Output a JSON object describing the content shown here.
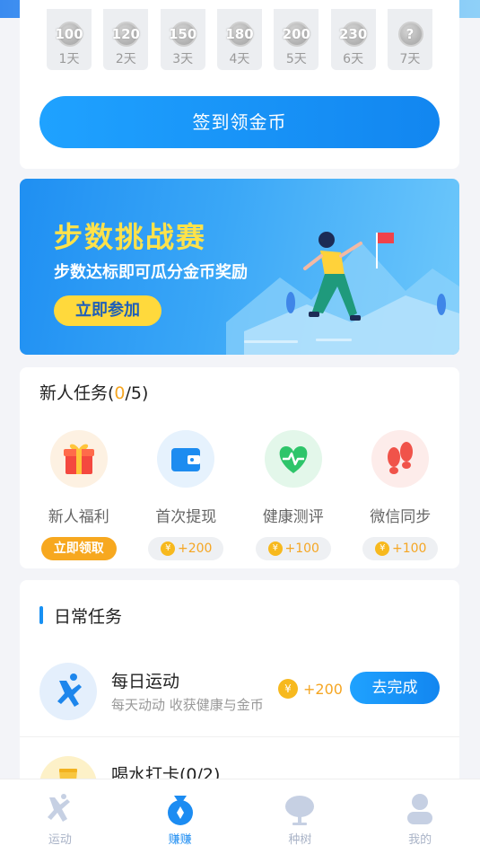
{
  "signin": {
    "days": [
      {
        "value": "100",
        "label": "1天"
      },
      {
        "value": "120",
        "label": "2天"
      },
      {
        "value": "150",
        "label": "3天"
      },
      {
        "value": "180",
        "label": "4天"
      },
      {
        "value": "200",
        "label": "5天"
      },
      {
        "value": "230",
        "label": "6天"
      },
      {
        "value": "?",
        "label": "7天"
      }
    ],
    "button_label": "签到领金币"
  },
  "banner": {
    "title": "步数挑战赛",
    "subtitle": "步数达标即可瓜分金币奖励",
    "button_label": "立即参加"
  },
  "new_tasks": {
    "title_prefix": "新人任务(",
    "done": "0",
    "title_suffix": "/5)",
    "items": [
      {
        "name": "新人福利",
        "action": "立即领取",
        "icon": "gift-icon"
      },
      {
        "name": "首次提现",
        "reward": "+200",
        "icon": "wallet-icon"
      },
      {
        "name": "健康测评",
        "reward": "+100",
        "icon": "heart-pulse-icon"
      },
      {
        "name": "微信同步",
        "reward": "+100",
        "icon": "footprints-icon"
      }
    ]
  },
  "daily_tasks": {
    "title": "日常任务",
    "items": [
      {
        "title": "每日运动",
        "subtitle": "每天动动 收获健康与金币",
        "reward": "+200",
        "button": "去完成",
        "icon": "runner-icon"
      },
      {
        "title": "喝水打卡(0/2)",
        "icon": "water-cup-icon"
      }
    ]
  },
  "coin_symbol": "¥",
  "nav": {
    "items": [
      {
        "label": "运动",
        "icon": "runner-icon",
        "active": false
      },
      {
        "label": "赚赚",
        "icon": "money-bag-icon",
        "active": true
      },
      {
        "label": "种树",
        "icon": "tree-icon",
        "active": false
      },
      {
        "label": "我的",
        "icon": "profile-icon",
        "active": false
      }
    ]
  },
  "colors": {
    "primary": "#1790f3",
    "coin": "#f7b91e",
    "reward_text": "#f5a623",
    "banner_title": "#ffe24a"
  }
}
